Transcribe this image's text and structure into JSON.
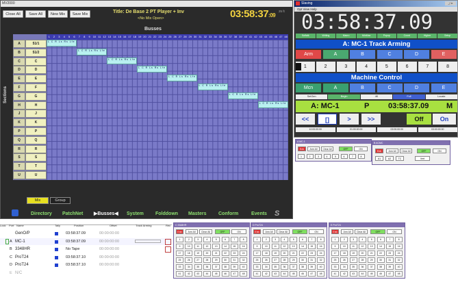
{
  "mixer": {
    "window_title": "MV2000",
    "buttons": [
      "Close All",
      "Save All",
      "New Mix",
      "Save Mix"
    ],
    "title": "Title: De Base 2 PT Player + Inv",
    "subtitle": "<No Mix Open>",
    "timecode_main": "03:58:37",
    "timecode_frames": ":09",
    "frame_rate": "25 ft",
    "busses_label": "Busses",
    "sections_label": "Sections",
    "rows": [
      {
        "letter": "A",
        "name": "51/1"
      },
      {
        "letter": "B",
        "name": "51/2"
      },
      {
        "letter": "C",
        "name": "C"
      },
      {
        "letter": "D",
        "name": "D"
      },
      {
        "letter": "E",
        "name": "E"
      },
      {
        "letter": "F",
        "name": "F"
      },
      {
        "letter": "G",
        "name": "G"
      },
      {
        "letter": "H",
        "name": "H"
      },
      {
        "letter": "J",
        "name": "J"
      },
      {
        "letter": "K",
        "name": "K"
      },
      {
        "letter": "P",
        "name": "P"
      },
      {
        "letter": "Q",
        "name": "Q"
      },
      {
        "letter": "R",
        "name": "R"
      },
      {
        "letter": "S",
        "name": "S"
      },
      {
        "letter": "T",
        "name": "T"
      },
      {
        "letter": "U",
        "name": "U"
      }
    ],
    "assign_text": "L C R Ls Rs Lfe",
    "tabs": [
      "Mix",
      "Group"
    ],
    "nav": [
      "Directory",
      "PatchNet",
      "▶Busses◀",
      "System",
      "Folddown",
      "Masters",
      "Conform",
      "Events"
    ]
  },
  "sync": {
    "window_title": "Slaving",
    "menu": "Opt  View  Help",
    "big_timecode": "03:58:37.09",
    "modes": [
      "Softalk",
      "Writing",
      "Macro",
      "MinMax",
      "Popup",
      "Coord",
      "Higher",
      "Setup"
    ],
    "arming_title": "A: MC-1   Track Arming",
    "arm_buttons": [
      "Arm",
      "A",
      "B",
      "C",
      "D",
      "E"
    ],
    "numbers": [
      "1",
      "2",
      "3",
      "4",
      "5",
      "6",
      "7",
      "8"
    ],
    "machine_title": "Machine Control",
    "mcn_buttons": [
      "Mcn",
      "A",
      "B",
      "C",
      "D",
      "E"
    ],
    "ctrl_buttons": [
      "SetGen",
      "Begin",
      "4K",
      "Full",
      "Locate"
    ],
    "status_machine": "A: MC-1",
    "status_p": "P",
    "status_tc": "03:58:37.09",
    "status_m": "M",
    "transport": [
      "<<",
      "[]",
      ">",
      ">>"
    ],
    "off_label": "Off",
    "on_label": "On",
    "locate_tcs": [
      "10:00:00:00",
      "01:00:00:00",
      "02:00:00:00",
      "03:00:00:00"
    ]
  },
  "arm_panel_1": {
    "title": "A MC-1",
    "enb": "Enb",
    "arm_all": "Arm All",
    "clear_all": "Clear All",
    "off": "OFF",
    "on": "ON",
    "nums": [
      "1",
      "2",
      "3",
      "4",
      "5",
      "6",
      "7",
      "8"
    ]
  },
  "arm_panel_2": {
    "title": "B ACMC",
    "enb": "Enb",
    "arm_all": "Arm All",
    "clear_all": "Clear All",
    "off": "OFF",
    "on": "ON",
    "nums": [
      "A1",
      "A2",
      "TC",
      "Vert"
    ]
  },
  "machines": {
    "headers": {
      "lock": "Lock",
      "port": "Port",
      "name": "Name",
      "tally": "Tally",
      "position": "Position",
      "offset": "Offset",
      "arming": "Track Arming",
      "rec": "Rec"
    },
    "rows": [
      {
        "port": "",
        "name": "GenO/P",
        "position": "03:58:37.09",
        "offset": "00:00:00:00"
      },
      {
        "port": "A",
        "name": "MC-1",
        "position": "03:58:37.09",
        "offset": "00:00:00:00"
      },
      {
        "port": "B",
        "name": "3348HR",
        "position": "No Tape",
        "offset": "00:00:00:00"
      },
      {
        "port": "C",
        "name": "ProT24",
        "position": "03:58:37.10",
        "offset": "00:00:00:00"
      },
      {
        "port": "D",
        "name": "ProT24",
        "position": "03:58:37.10",
        "offset": "00:00:00:00"
      },
      {
        "port": "E",
        "name": "N/C",
        "position": "",
        "offset": ""
      }
    ]
  },
  "grid_panels": [
    {
      "title": "C 3348HR",
      "enb": "Enb",
      "arm_all": "Arm All",
      "clear_all": "Clear All",
      "off": "OFF",
      "on": "ON"
    },
    {
      "title": "D ProT24",
      "enb": "Enb",
      "arm_all": "Arm All",
      "clear_all": "Clear All",
      "off": "OFF",
      "on": "ON"
    },
    {
      "title": "E ProT24",
      "enb": "Enb",
      "arm_all": "Arm All",
      "clear_all": "Clear All",
      "off": "OFF",
      "on": "ON"
    }
  ]
}
